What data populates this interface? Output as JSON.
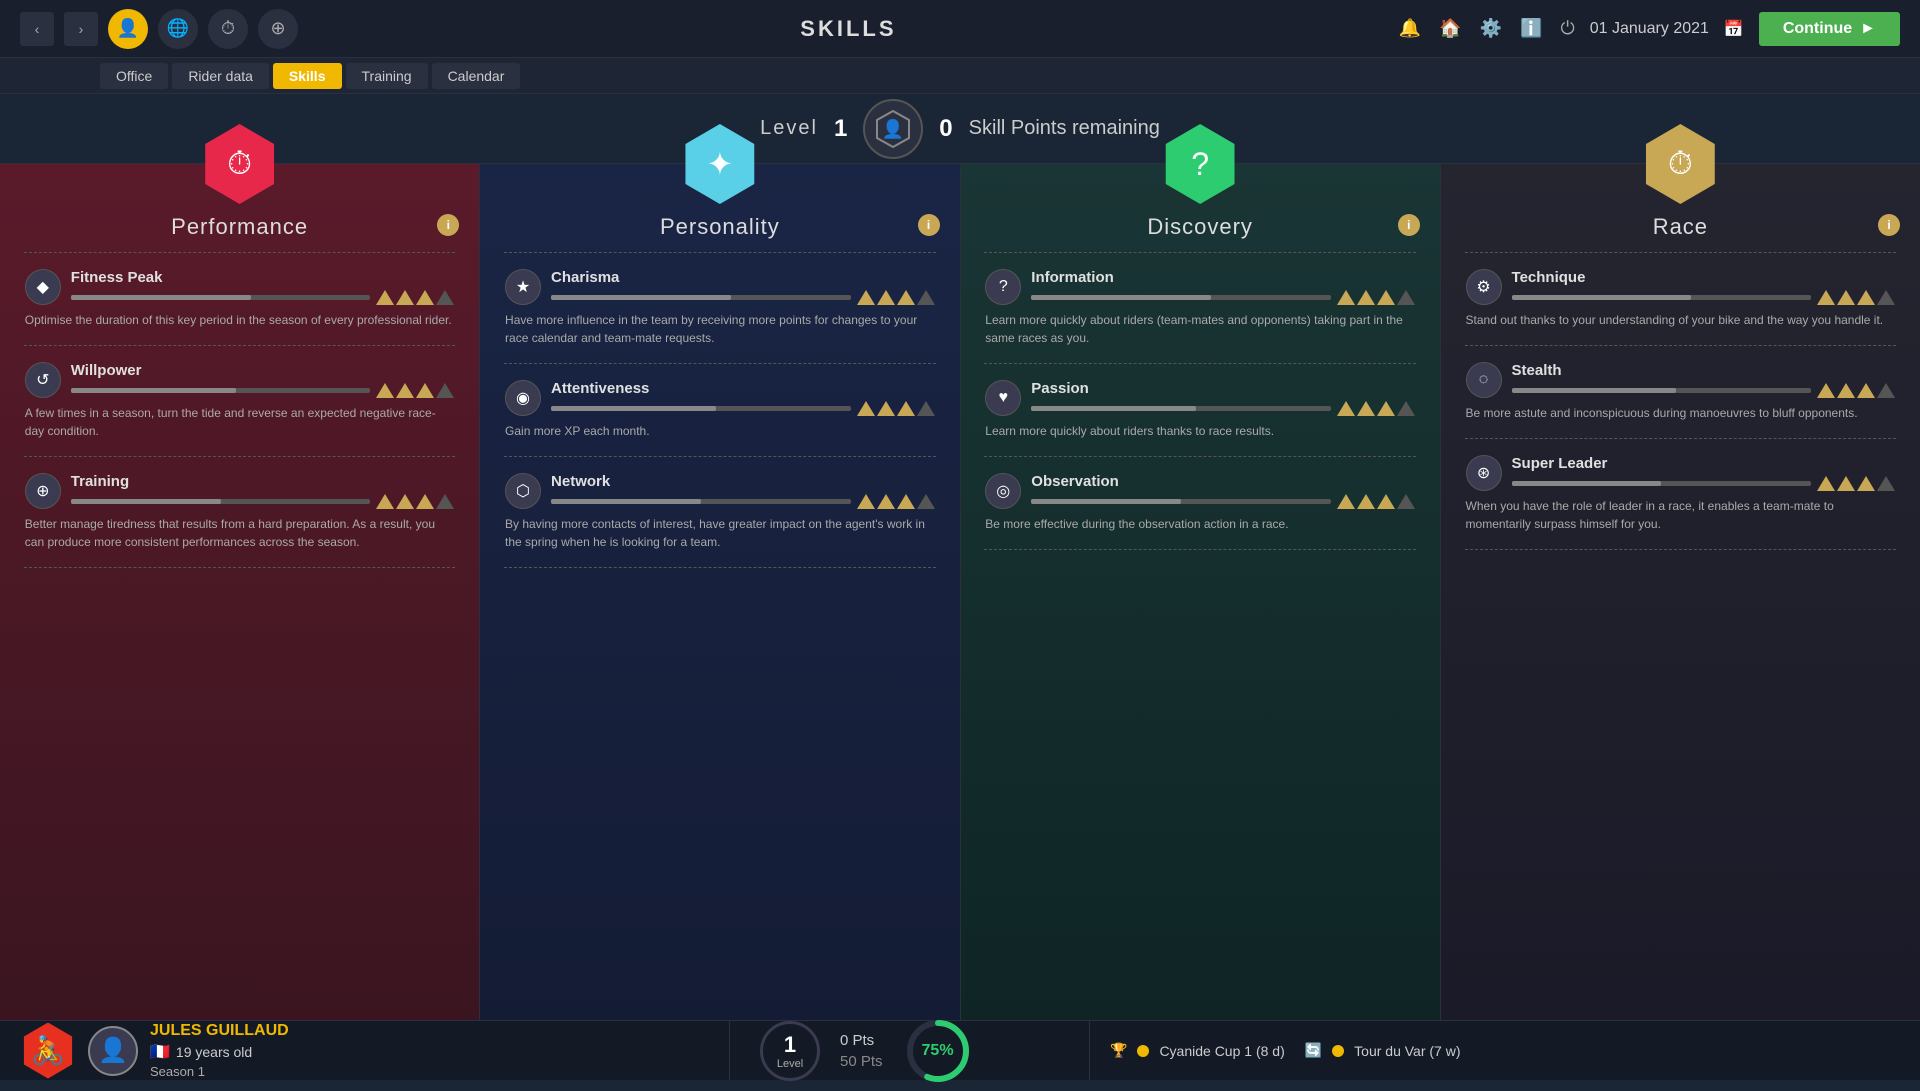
{
  "topbar": {
    "title": "SKILLS",
    "date": "01 January 2021",
    "continue_label": "Continue",
    "icons": [
      "🔔",
      "🏠",
      "⚙️",
      "ℹ️",
      "⏻"
    ]
  },
  "subnav": {
    "items": [
      {
        "label": "Office",
        "active": false
      },
      {
        "label": "Rider data",
        "active": false
      },
      {
        "label": "Skills",
        "active": true
      },
      {
        "label": "Training",
        "active": false
      },
      {
        "label": "Calendar",
        "active": false
      }
    ]
  },
  "level": {
    "label": "Level",
    "value": "1",
    "skill_points": "0",
    "skill_points_label": "Skill Points remaining"
  },
  "cards": [
    {
      "id": "performance",
      "title": "Performance",
      "hex_color": "red",
      "hex_icon": "⏱",
      "skills": [
        {
          "name": "Fitness Peak",
          "icon": "◆",
          "bars": 3,
          "desc": "Optimise the duration of this key period in the season of every professional rider."
        },
        {
          "name": "Willpower",
          "icon": "↺",
          "bars": 3,
          "desc": "A few times in a season, turn the tide and reverse an expected negative race-day condition."
        },
        {
          "name": "Training",
          "icon": "⊕",
          "bars": 3,
          "desc": "Better manage tiredness that results from a hard preparation. As a result, you can produce more consistent performances across the season."
        }
      ]
    },
    {
      "id": "personality",
      "title": "Personality",
      "hex_color": "cyan",
      "hex_icon": "✦",
      "skills": [
        {
          "name": "Charisma",
          "icon": "★",
          "bars": 3,
          "desc": "Have more influence in the team by receiving more points for changes to your race calendar and team-mate requests."
        },
        {
          "name": "Attentiveness",
          "icon": "◉",
          "bars": 3,
          "desc": "Gain more XP each month."
        },
        {
          "name": "Network",
          "icon": "⬡",
          "bars": 3,
          "desc": "By having more contacts of interest, have greater impact on the agent's work in the spring when he is looking for a team."
        }
      ]
    },
    {
      "id": "discovery",
      "title": "Discovery",
      "hex_color": "green",
      "hex_icon": "?",
      "skills": [
        {
          "name": "Information",
          "icon": "?",
          "bars": 3,
          "desc": "Learn more quickly about riders (team-mates and opponents) taking part in the same races as you."
        },
        {
          "name": "Passion",
          "icon": "♥",
          "bars": 3,
          "desc": "Learn more quickly about riders thanks to race results."
        },
        {
          "name": "Observation",
          "icon": "◎",
          "bars": 3,
          "desc": "Be more effective during the observation action in a race."
        }
      ]
    },
    {
      "id": "race",
      "title": "Race",
      "hex_color": "gold",
      "hex_icon": "⏱",
      "skills": [
        {
          "name": "Technique",
          "icon": "⚙",
          "bars": 3,
          "desc": "Stand out thanks to your understanding of your bike and the way you handle it."
        },
        {
          "name": "Stealth",
          "icon": "◌",
          "bars": 3,
          "desc": "Be more astute and inconspicuous during manoeuvres to bluff opponents."
        },
        {
          "name": "Super Leader",
          "icon": "⊛",
          "bars": 3,
          "desc": "When you have the role of leader in a race, it enables a team-mate to momentarily surpass himself for you."
        }
      ]
    }
  ],
  "rider": {
    "name": "JULES GUILLAUD",
    "age": "19 years old",
    "season": "Season 1",
    "flag": "🇫🇷",
    "level_label": "Level",
    "level_value": "1",
    "pts_current": "0 Pts",
    "pts_total": "50 Pts",
    "progress_pct": "75%"
  },
  "races": [
    {
      "icon": "🏆",
      "label": "Cyanide Cup 1 (8 d)"
    },
    {
      "icon": "🔄",
      "label": "Tour du Var (7 w)"
    }
  ]
}
